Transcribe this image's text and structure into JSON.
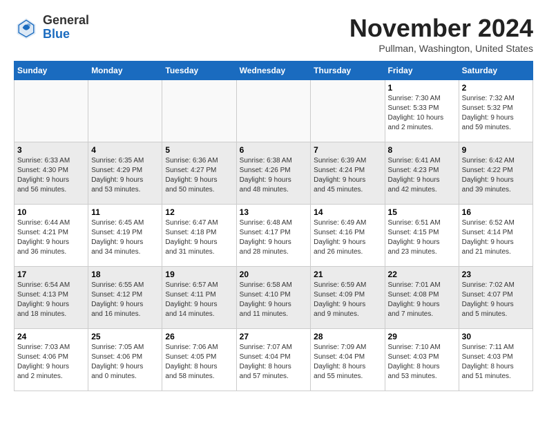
{
  "header": {
    "logo_general": "General",
    "logo_blue": "Blue",
    "month_title": "November 2024",
    "subtitle": "Pullman, Washington, United States"
  },
  "weekdays": [
    "Sunday",
    "Monday",
    "Tuesday",
    "Wednesday",
    "Thursday",
    "Friday",
    "Saturday"
  ],
  "weeks": [
    {
      "shade": "normal",
      "days": [
        {
          "num": "",
          "info": ""
        },
        {
          "num": "",
          "info": ""
        },
        {
          "num": "",
          "info": ""
        },
        {
          "num": "",
          "info": ""
        },
        {
          "num": "",
          "info": ""
        },
        {
          "num": "1",
          "info": "Sunrise: 7:30 AM\nSunset: 5:33 PM\nDaylight: 10 hours\nand 2 minutes."
        },
        {
          "num": "2",
          "info": "Sunrise: 7:32 AM\nSunset: 5:32 PM\nDaylight: 9 hours\nand 59 minutes."
        }
      ]
    },
    {
      "shade": "shaded",
      "days": [
        {
          "num": "3",
          "info": "Sunrise: 6:33 AM\nSunset: 4:30 PM\nDaylight: 9 hours\nand 56 minutes."
        },
        {
          "num": "4",
          "info": "Sunrise: 6:35 AM\nSunset: 4:29 PM\nDaylight: 9 hours\nand 53 minutes."
        },
        {
          "num": "5",
          "info": "Sunrise: 6:36 AM\nSunset: 4:27 PM\nDaylight: 9 hours\nand 50 minutes."
        },
        {
          "num": "6",
          "info": "Sunrise: 6:38 AM\nSunset: 4:26 PM\nDaylight: 9 hours\nand 48 minutes."
        },
        {
          "num": "7",
          "info": "Sunrise: 6:39 AM\nSunset: 4:24 PM\nDaylight: 9 hours\nand 45 minutes."
        },
        {
          "num": "8",
          "info": "Sunrise: 6:41 AM\nSunset: 4:23 PM\nDaylight: 9 hours\nand 42 minutes."
        },
        {
          "num": "9",
          "info": "Sunrise: 6:42 AM\nSunset: 4:22 PM\nDaylight: 9 hours\nand 39 minutes."
        }
      ]
    },
    {
      "shade": "normal",
      "days": [
        {
          "num": "10",
          "info": "Sunrise: 6:44 AM\nSunset: 4:21 PM\nDaylight: 9 hours\nand 36 minutes."
        },
        {
          "num": "11",
          "info": "Sunrise: 6:45 AM\nSunset: 4:19 PM\nDaylight: 9 hours\nand 34 minutes."
        },
        {
          "num": "12",
          "info": "Sunrise: 6:47 AM\nSunset: 4:18 PM\nDaylight: 9 hours\nand 31 minutes."
        },
        {
          "num": "13",
          "info": "Sunrise: 6:48 AM\nSunset: 4:17 PM\nDaylight: 9 hours\nand 28 minutes."
        },
        {
          "num": "14",
          "info": "Sunrise: 6:49 AM\nSunset: 4:16 PM\nDaylight: 9 hours\nand 26 minutes."
        },
        {
          "num": "15",
          "info": "Sunrise: 6:51 AM\nSunset: 4:15 PM\nDaylight: 9 hours\nand 23 minutes."
        },
        {
          "num": "16",
          "info": "Sunrise: 6:52 AM\nSunset: 4:14 PM\nDaylight: 9 hours\nand 21 minutes."
        }
      ]
    },
    {
      "shade": "shaded",
      "days": [
        {
          "num": "17",
          "info": "Sunrise: 6:54 AM\nSunset: 4:13 PM\nDaylight: 9 hours\nand 18 minutes."
        },
        {
          "num": "18",
          "info": "Sunrise: 6:55 AM\nSunset: 4:12 PM\nDaylight: 9 hours\nand 16 minutes."
        },
        {
          "num": "19",
          "info": "Sunrise: 6:57 AM\nSunset: 4:11 PM\nDaylight: 9 hours\nand 14 minutes."
        },
        {
          "num": "20",
          "info": "Sunrise: 6:58 AM\nSunset: 4:10 PM\nDaylight: 9 hours\nand 11 minutes."
        },
        {
          "num": "21",
          "info": "Sunrise: 6:59 AM\nSunset: 4:09 PM\nDaylight: 9 hours\nand 9 minutes."
        },
        {
          "num": "22",
          "info": "Sunrise: 7:01 AM\nSunset: 4:08 PM\nDaylight: 9 hours\nand 7 minutes."
        },
        {
          "num": "23",
          "info": "Sunrise: 7:02 AM\nSunset: 4:07 PM\nDaylight: 9 hours\nand 5 minutes."
        }
      ]
    },
    {
      "shade": "normal",
      "days": [
        {
          "num": "24",
          "info": "Sunrise: 7:03 AM\nSunset: 4:06 PM\nDaylight: 9 hours\nand 2 minutes."
        },
        {
          "num": "25",
          "info": "Sunrise: 7:05 AM\nSunset: 4:06 PM\nDaylight: 9 hours\nand 0 minutes."
        },
        {
          "num": "26",
          "info": "Sunrise: 7:06 AM\nSunset: 4:05 PM\nDaylight: 8 hours\nand 58 minutes."
        },
        {
          "num": "27",
          "info": "Sunrise: 7:07 AM\nSunset: 4:04 PM\nDaylight: 8 hours\nand 57 minutes."
        },
        {
          "num": "28",
          "info": "Sunrise: 7:09 AM\nSunset: 4:04 PM\nDaylight: 8 hours\nand 55 minutes."
        },
        {
          "num": "29",
          "info": "Sunrise: 7:10 AM\nSunset: 4:03 PM\nDaylight: 8 hours\nand 53 minutes."
        },
        {
          "num": "30",
          "info": "Sunrise: 7:11 AM\nSunset: 4:03 PM\nDaylight: 8 hours\nand 51 minutes."
        }
      ]
    }
  ]
}
